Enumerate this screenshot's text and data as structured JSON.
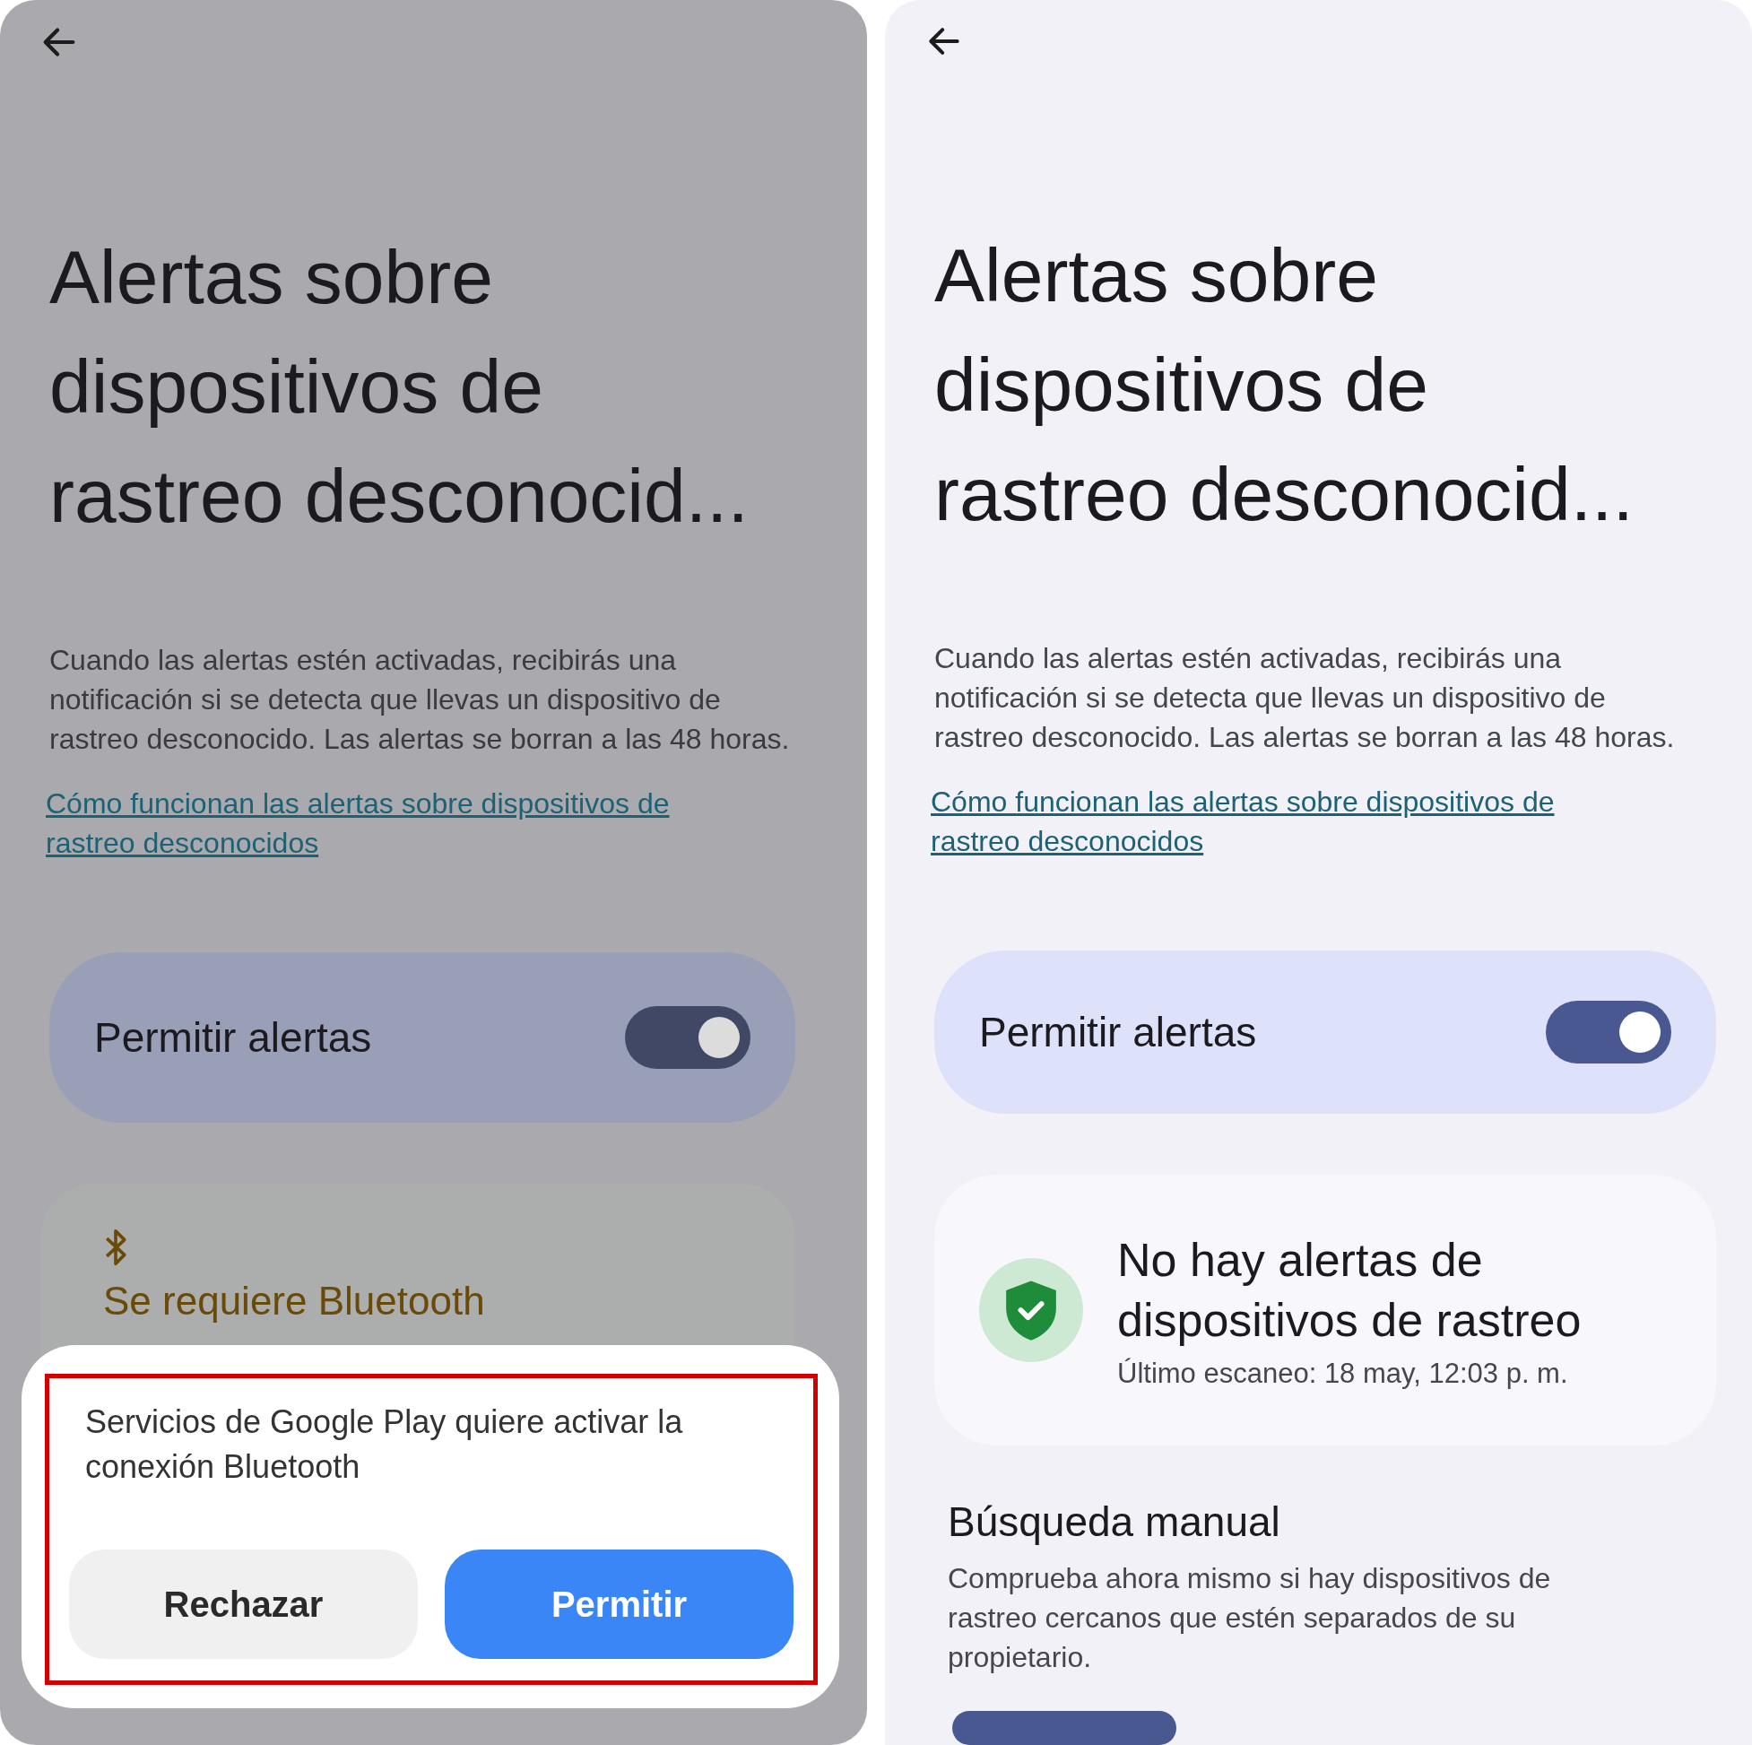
{
  "screens": [
    {
      "kind": "consent",
      "dimmed": true,
      "title": "Alertas sobre dispositivos de rastreo desconocid...",
      "description": "Cuando las alertas estén activadas, recibirás una notificación si se detecta que llevas un dispositivo de rastreo desconocido. Las alertas se borran a las 48 horas.",
      "link": "Cómo funcionan las alertas sobre dispositivos de rastreo desconocidos",
      "toggle": {
        "label": "Permitir alertas",
        "on": true
      },
      "bluetooth_card": {
        "text": "Se requiere Bluetooth"
      },
      "dialog": {
        "message": "Servicios de Google Play quiere activar la conexión Bluetooth",
        "highlighted": true,
        "buttons": [
          {
            "label": "Rechazar",
            "kind": "secondary"
          },
          {
            "label": "Permitir",
            "kind": "primary"
          }
        ]
      }
    },
    {
      "kind": "status",
      "dimmed": false,
      "title": "Alertas sobre dispositivos de rastreo desconocid...",
      "description": "Cuando las alertas estén activadas, recibirás una notificación si se detecta que llevas un dispositivo de rastreo desconocido. Las alertas se borran a las 48 horas.",
      "link": "Cómo funcionan las alertas sobre dispositivos de rastreo desconocidos",
      "toggle": {
        "label": "Permitir alertas",
        "on": true
      },
      "status_card": {
        "title": "No hay alertas de dispositivos de rastreo",
        "subtitle": "Último escaneo: 18 may, 12:03 p. m."
      },
      "manual_search": {
        "title": "Búsqueda manual",
        "description": "Comprueba ahora mismo si hay dispositivos de rastreo cercanos que estén separados de su propietario."
      }
    }
  ]
}
